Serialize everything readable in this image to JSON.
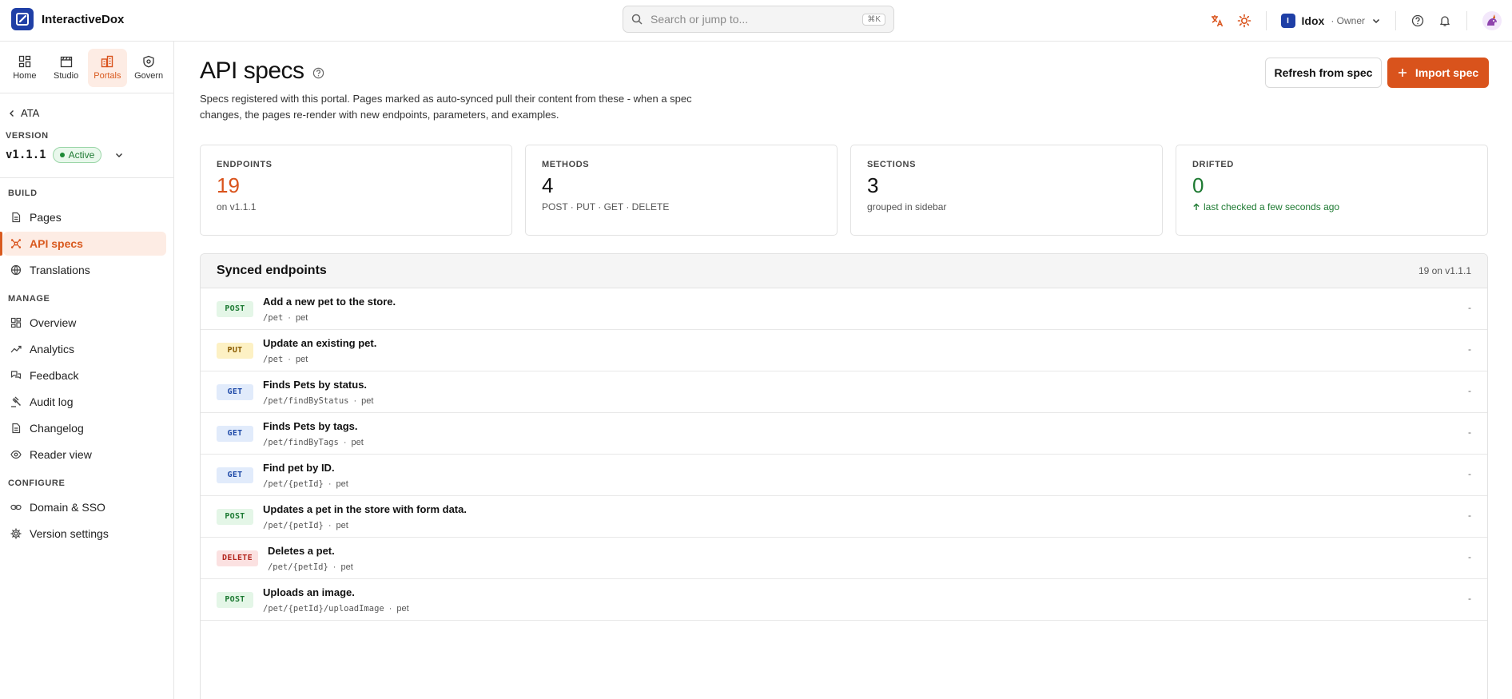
{
  "app": {
    "name": "InteractiveDox"
  },
  "search": {
    "placeholder": "Search or jump to...",
    "shortcut": "⌘K"
  },
  "org": {
    "initial": "I",
    "name": "Idox",
    "role": "· Owner"
  },
  "rail": [
    {
      "label": "Home",
      "icon": "grid-icon"
    },
    {
      "label": "Studio",
      "icon": "clapperboard-icon"
    },
    {
      "label": "Portals",
      "icon": "buildings-icon",
      "active": true
    },
    {
      "label": "Govern",
      "icon": "shield-icon"
    }
  ],
  "sidebar": {
    "back_label": "ATA",
    "version_label": "VERSION",
    "version": "v1.1.1",
    "version_status": "Active",
    "sections": {
      "build": "BUILD",
      "manage": "MANAGE",
      "configure": "CONFIGURE"
    },
    "build_items": [
      {
        "label": "Pages"
      },
      {
        "label": "API specs",
        "active": true
      },
      {
        "label": "Translations"
      }
    ],
    "manage_items": [
      {
        "label": "Overview"
      },
      {
        "label": "Analytics"
      },
      {
        "label": "Feedback"
      },
      {
        "label": "Audit log"
      },
      {
        "label": "Changelog"
      },
      {
        "label": "Reader view"
      }
    ],
    "configure_items": [
      {
        "label": "Domain & SSO"
      },
      {
        "label": "Version settings"
      }
    ]
  },
  "page": {
    "title": "API specs",
    "description": "Specs registered with this portal. Pages marked as auto-synced pull their content from these - when a spec changes, the pages re-render with new endpoints, parameters, and examples.",
    "refresh_label": "Refresh from spec",
    "import_label": "Import spec"
  },
  "stats": [
    {
      "label": "ENDPOINTS",
      "value": "19",
      "sub": "on v1.1.1",
      "color": "#d9531c"
    },
    {
      "label": "METHODS",
      "value": "4",
      "sub": "POST · PUT · GET · DELETE",
      "color": "#111111"
    },
    {
      "label": "SECTIONS",
      "value": "3",
      "sub": "grouped in sidebar",
      "color": "#111111"
    },
    {
      "label": "DRIFTED",
      "value": "0",
      "sub": "last checked a few seconds ago",
      "color": "#1e7a32"
    }
  ],
  "endpoints": {
    "title": "Synced endpoints",
    "count": "19 on v1.1.1",
    "rows": [
      {
        "method": "POST",
        "summary": "Add a new pet to the store.",
        "path": "/pet",
        "tag": "pet",
        "status": "-"
      },
      {
        "method": "PUT",
        "summary": "Update an existing pet.",
        "path": "/pet",
        "tag": "pet",
        "status": "-"
      },
      {
        "method": "GET",
        "summary": "Finds Pets by status.",
        "path": "/pet/findByStatus",
        "tag": "pet",
        "status": "-"
      },
      {
        "method": "GET",
        "summary": "Finds Pets by tags.",
        "path": "/pet/findByTags",
        "tag": "pet",
        "status": "-"
      },
      {
        "method": "GET",
        "summary": "Find pet by ID.",
        "path": "/pet/{petId}",
        "tag": "pet",
        "status": "-"
      },
      {
        "method": "POST",
        "summary": "Updates a pet in the store with form data.",
        "path": "/pet/{petId}",
        "tag": "pet",
        "status": "-"
      },
      {
        "method": "DELETE",
        "summary": "Deletes a pet.",
        "path": "/pet/{petId}",
        "tag": "pet",
        "status": "-"
      },
      {
        "method": "POST",
        "summary": "Uploads an image.",
        "path": "/pet/{petId}/uploadImage",
        "tag": "pet",
        "status": "-"
      }
    ]
  },
  "colors": {
    "accent": "#d9531c",
    "brand": "#1f3fa6",
    "success": "#1e7a32"
  }
}
